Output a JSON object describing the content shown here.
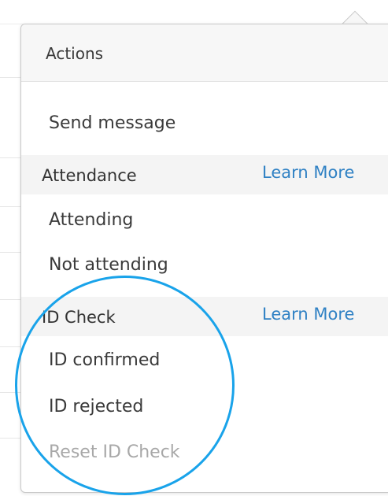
{
  "popover": {
    "title": "Actions",
    "send_message": "Send message",
    "sections": [
      {
        "label": "Attendance",
        "link": "Learn More",
        "items": [
          {
            "label": "Attending",
            "disabled": false
          },
          {
            "label": "Not attending",
            "disabled": false
          }
        ]
      },
      {
        "label": "ID Check",
        "link": "Learn More",
        "items": [
          {
            "label": "ID confirmed",
            "disabled": false
          },
          {
            "label": "ID rejected",
            "disabled": false
          },
          {
            "label": "Reset ID Check",
            "disabled": true
          }
        ]
      }
    ]
  },
  "colors": {
    "link": "#2f81c4",
    "highlight_ring": "#19a3ea",
    "text": "#3a3a3a",
    "disabled_text": "#a8a8a8"
  }
}
